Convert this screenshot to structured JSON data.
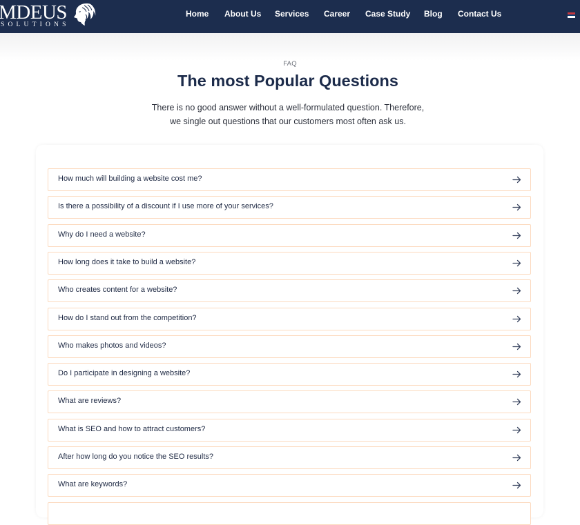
{
  "header": {
    "logo": {
      "main_text": "MDEUS",
      "sub_text": "SOLUTIONS",
      "emblem_icon": "lion-head-icon"
    },
    "nav": [
      {
        "label": "Home"
      },
      {
        "label": "About Us"
      },
      {
        "label": "Services"
      },
      {
        "label": "Career"
      },
      {
        "label": "Case Study"
      },
      {
        "label": "Blog"
      },
      {
        "label": "Contact Us"
      }
    ],
    "language_flag": {
      "icon": "serbian-flag-icon",
      "colors": [
        "#c6363c",
        "#0c4076",
        "#ffffff"
      ]
    }
  },
  "faq_section": {
    "eyebrow": "FAQ",
    "title": "The most Popular Questions",
    "subtitle": "There is no good answer without a well-formulated question. Therefore, we single out questions that our customers most often ask us.",
    "items": [
      {
        "question": "How much will building a website cost me?"
      },
      {
        "question": "Is there a possibility of a discount if I use more of your services?"
      },
      {
        "question": "Why do I need a website?"
      },
      {
        "question": "How long does it take to build a website?"
      },
      {
        "question": "Who creates content for a website?"
      },
      {
        "question": "How do I stand out from the competition?"
      },
      {
        "question": "Who makes photos and videos?"
      },
      {
        "question": "Do I participate in designing a website?"
      },
      {
        "question": "What are reviews?"
      },
      {
        "question": "What is SEO and how to attract customers?"
      },
      {
        "question": "After how long do you notice the SEO results?"
      },
      {
        "question": "What are keywords?"
      },
      {
        "question": ""
      }
    ],
    "item_icon": "arrow-right-icon"
  },
  "colors": {
    "navbar_bg": "#1c2d4e",
    "heading": "#1c2b4a",
    "item_border": "#fcd9bd",
    "arrow": "#3a4560"
  }
}
